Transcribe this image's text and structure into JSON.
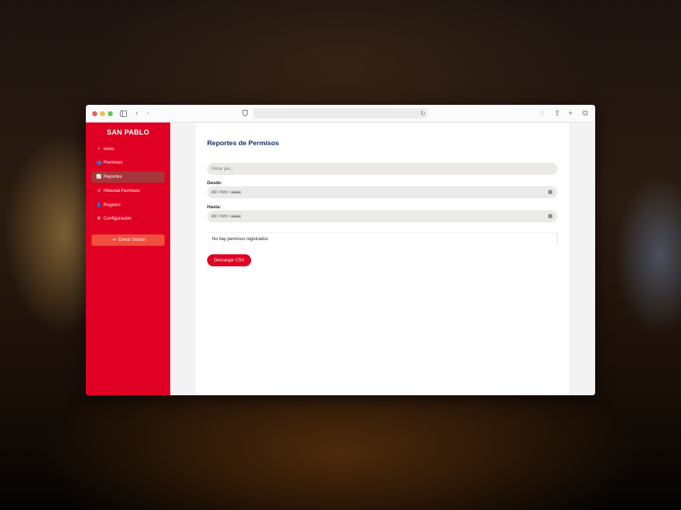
{
  "sidebar": {
    "brand": "SAN PABLO",
    "items": [
      {
        "label": "Inicio",
        "icon": "home-icon",
        "glyph": "⌂",
        "active": false
      },
      {
        "label": "Permisos",
        "icon": "users-icon",
        "glyph": "👥",
        "active": false
      },
      {
        "label": "Reportes",
        "icon": "chart-icon",
        "glyph": "📈",
        "active": true
      },
      {
        "label": "Historial Permisos",
        "icon": "history-icon",
        "glyph": "↺",
        "active": false
      },
      {
        "label": "Registro",
        "icon": "user-plus-icon",
        "glyph": "👤",
        "active": false
      },
      {
        "label": "Configuración",
        "icon": "gear-icon",
        "glyph": "⚙",
        "active": false
      }
    ],
    "logout_label": "Cerrar Sesión",
    "logout_icon": "sign-out-icon"
  },
  "main": {
    "title": "Reportes de Permisos",
    "filter_placeholder": "Filtrar por...",
    "desde_label": "Desde:",
    "desde_value": "dd / mm / aaaa",
    "hasta_label": "Hasta:",
    "hasta_value": "dd / mm / aaaa",
    "empty_message": "No hay permisos registrados",
    "download_label": "Descargar CSV"
  },
  "colors": {
    "sidebar": "#e00023",
    "active_item": "#a5363a",
    "logout": "#f04f3d",
    "title": "#122a5c"
  }
}
